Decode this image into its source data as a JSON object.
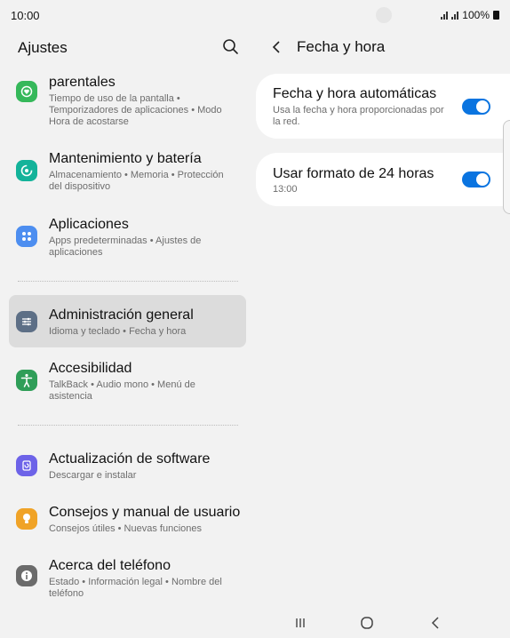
{
  "status_bar": {
    "time": "10:00",
    "battery": "100%"
  },
  "left": {
    "title": "Ajustes",
    "items": [
      {
        "title": "parentales",
        "subtitle": "Tiempo de uso de la pantalla  •  Temporizadores de aplicaciones  •  Modo Hora de acostarse",
        "icon": "parental-controls-icon",
        "color": "#35b85a"
      },
      {
        "title": "Mantenimiento y batería",
        "subtitle": "Almacenamiento  •  Memoria  •  Protección del dispositivo",
        "icon": "device-care-icon",
        "color": "#13b39a"
      },
      {
        "title": "Aplicaciones",
        "subtitle": "Apps predeterminadas  •  Ajustes de aplicaciones",
        "icon": "apps-icon",
        "color": "#4d8ef0"
      },
      {
        "title": "Administración general",
        "subtitle": "Idioma y teclado  •  Fecha y hora",
        "icon": "sliders-icon",
        "color": "#5d6f86"
      },
      {
        "title": "Accesibilidad",
        "subtitle": "TalkBack  •  Audio mono  •  Menú de asistencia",
        "icon": "accessibility-icon",
        "color": "#2f9e58"
      },
      {
        "title": "Actualización de software",
        "subtitle": "Descargar e instalar",
        "icon": "software-update-icon",
        "color": "#6d63e8"
      },
      {
        "title": "Consejos y manual de usuario",
        "subtitle": "Consejos útiles  •  Nuevas funciones",
        "icon": "tips-bulb-icon",
        "color": "#f0a327"
      },
      {
        "title": "Acerca del teléfono",
        "subtitle": "Estado  •  Información legal  •  Nombre del teléfono",
        "icon": "info-icon",
        "color": "#6b6b6b"
      }
    ]
  },
  "right": {
    "title": "Fecha y hora",
    "settings": [
      {
        "title": "Fecha y hora automáticas",
        "subtitle": "Usa la fecha y hora proporcionadas por la red.",
        "enabled": true
      },
      {
        "title": "Usar formato de 24 horas",
        "subtitle": "13:00",
        "enabled": true
      }
    ]
  },
  "colors": {
    "accent": "#0a74e0",
    "selected_row": "#dcdcdc",
    "background": "#f2f2f2"
  }
}
